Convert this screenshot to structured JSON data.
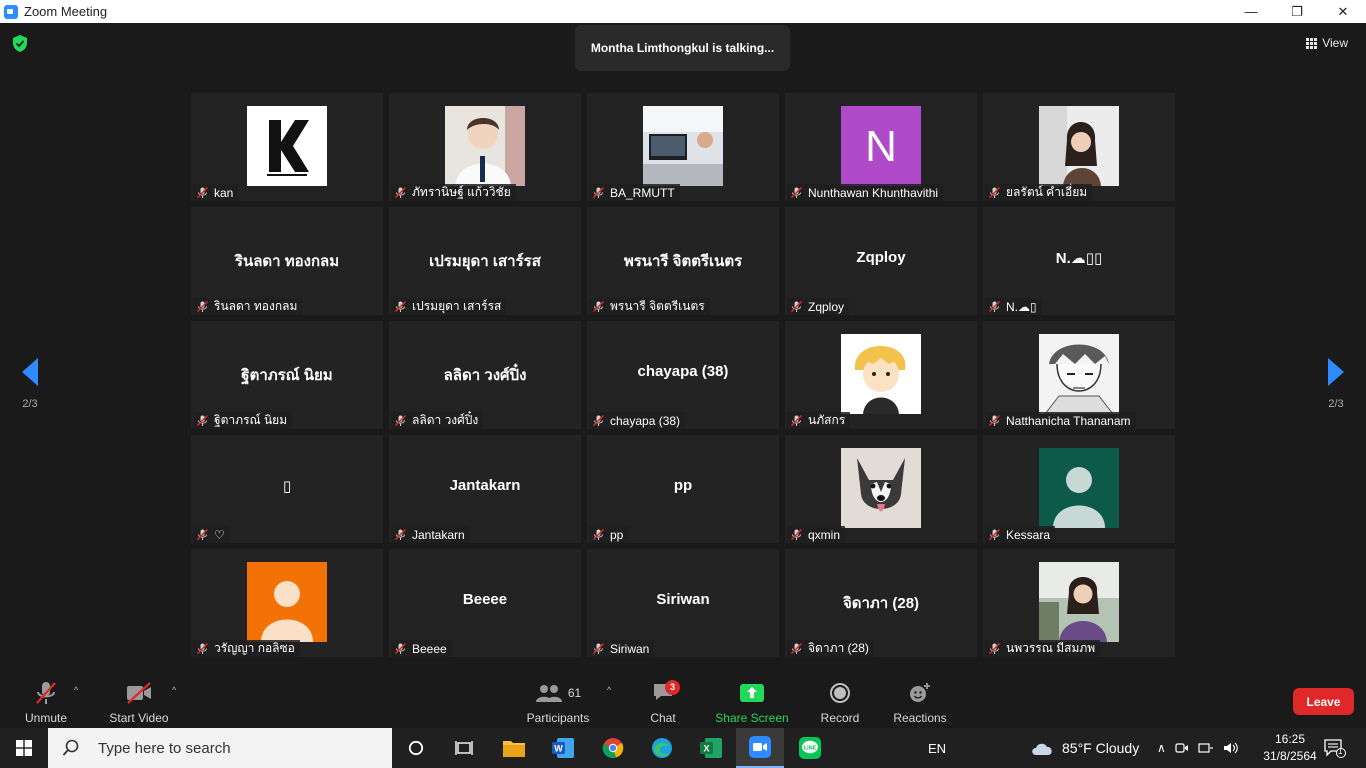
{
  "window": {
    "title": "Zoom Meeting",
    "minimize_glyph": "—",
    "maximize_glyph": "❐",
    "close_glyph": "✕"
  },
  "meeting": {
    "talking_text": "Montha Limthongkul is talking...",
    "view_label": "View",
    "page_indicator_left": "2/3",
    "page_indicator_right": "2/3",
    "tiles": [
      {
        "label": "kan",
        "avatar": "billkin-logo"
      },
      {
        "label": "ภัทรานิษฐ์ แก้ววิชัย",
        "avatar": "boy-photo"
      },
      {
        "label": "BA_RMUTT",
        "avatar": "office-photo"
      },
      {
        "label": "Nunthawan Khunthavithi",
        "avatar": "letter-n"
      },
      {
        "label": "ยลรัตน์ คำเอี่ยม",
        "avatar": "girl-photo"
      },
      {
        "label": "รินลดา ทองกลม",
        "name": "รินลดา ทองกลม"
      },
      {
        "label": "เปรมยุดา เสาร์รส",
        "name": "เปรมยุดา เสาร์รส"
      },
      {
        "label": "พรนารี จิตตรีเนตร",
        "name": "พรนารี จิตตรีเนตร"
      },
      {
        "label": "Zqploy",
        "name": "Zqploy"
      },
      {
        "label": "N.☁▯",
        "name": "N.☁▯▯"
      },
      {
        "label": "ฐิตาภรณ์ นิยม",
        "name": "ฐิตาภรณ์ นิยม"
      },
      {
        "label": "ลลิดา วงศ์ปิ๋ง",
        "name": "ลลิดา วงศ์ปิ๋ง"
      },
      {
        "label": "chayapa (38)",
        "name": "chayapa (38)"
      },
      {
        "label": "นภัสกร",
        "avatar": "cartoon-blond"
      },
      {
        "label": "Natthanicha Thananam",
        "avatar": "sketch-boy"
      },
      {
        "label": "♡",
        "name": "▯"
      },
      {
        "label": "Jantakarn",
        "name": "Jantakarn"
      },
      {
        "label": "pp",
        "name": "pp"
      },
      {
        "label": "qxmin",
        "avatar": "husky-drawing"
      },
      {
        "label": "Kessara",
        "avatar": "default-teal"
      },
      {
        "label": "วรัญญา กอลิซอ",
        "avatar": "default-orange"
      },
      {
        "label": "Beeee",
        "name": "Beeee"
      },
      {
        "label": "Siriwan",
        "name": "Siriwan"
      },
      {
        "label": "จิดาภา (28)",
        "name": "จิดาภา (28)"
      },
      {
        "label": "นพวรรณ มีสมภพ",
        "avatar": "girl-outdoor"
      }
    ]
  },
  "controls": {
    "unmute": "Unmute",
    "start_video": "Start Video",
    "participants_count": "61",
    "participants": "Participants",
    "chat_badge": "3",
    "chat": "Chat",
    "share_screen": "Share Screen",
    "record": "Record",
    "reactions": "Reactions",
    "leave": "Leave",
    "colors": {
      "share_green": "#23d959",
      "leave_red": "#e02828",
      "accent_blue": "#2d8cff"
    }
  },
  "taskbar": {
    "search_placeholder": "Type here to search",
    "language": "EN",
    "weather": "85°F  Cloudy",
    "time": "16:25",
    "date": "31/8/2564",
    "notification_count": "1"
  }
}
